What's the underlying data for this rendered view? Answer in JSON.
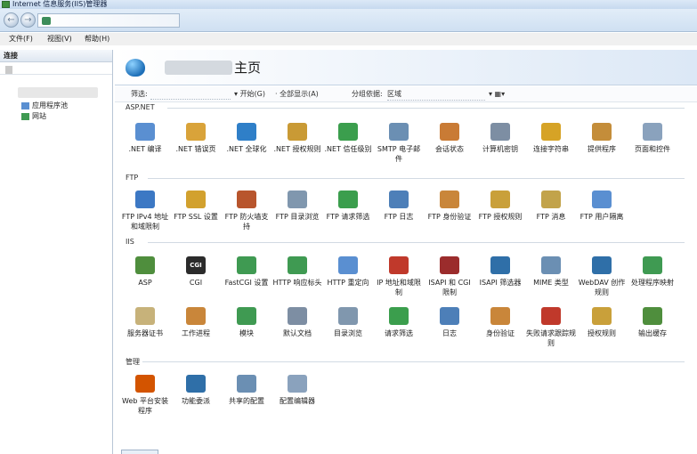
{
  "window": {
    "title": "Internet 信息服务(IIS)管理器"
  },
  "menu": [
    "文件(F)",
    "视图(V)",
    "帮助(H)"
  ],
  "connections": {
    "header": "连接",
    "tree": [
      {
        "label": "应用程序池",
        "icon": "app-pool-icon"
      },
      {
        "label": "网站",
        "icon": "sites-icon"
      }
    ]
  },
  "main": {
    "title": "主页",
    "filter": {
      "label": "筛选:",
      "start": "开始(G)",
      "show_all": "全部显示(A)",
      "group_by_label": "分组依据:",
      "group_by_value": "区域"
    },
    "sections": [
      {
        "name": "ASP.NET",
        "items": [
          {
            "label": ".NET 编译",
            "icon": "net-compile-icon",
            "color": "#5a8fd1"
          },
          {
            "label": ".NET 错误页",
            "icon": "net-error-page-icon",
            "color": "#d9a33a"
          },
          {
            "label": ".NET 全球化",
            "icon": "net-globalization-icon",
            "color": "#2f7fc8"
          },
          {
            "label": ".NET 授权规则",
            "icon": "net-authorization-icon",
            "color": "#c99a35"
          },
          {
            "label": ".NET 信任级别",
            "icon": "net-trust-level-icon",
            "color": "#3b9e4d"
          },
          {
            "label": "SMTP 电子邮件",
            "icon": "smtp-email-icon",
            "color": "#6b8fb3"
          },
          {
            "label": "会话状态",
            "icon": "session-state-icon",
            "color": "#c97b35"
          },
          {
            "label": "计算机密钥",
            "icon": "machine-key-icon",
            "color": "#7d8ea3"
          },
          {
            "label": "连接字符串",
            "icon": "connection-strings-icon",
            "color": "#d6a326"
          },
          {
            "label": "提供程序",
            "icon": "providers-icon",
            "color": "#c48d3a"
          },
          {
            "label": "页面和控件",
            "icon": "pages-controls-icon",
            "color": "#8aa2bd"
          }
        ]
      },
      {
        "name": "FTP",
        "items": [
          {
            "label": "FTP IPv4 地址和域限制",
            "icon": "ftp-ipv4-icon",
            "color": "#3c78c4"
          },
          {
            "label": "FTP SSL 设置",
            "icon": "ftp-ssl-icon",
            "color": "#d2a12e"
          },
          {
            "label": "FTP 防火墙支持",
            "icon": "ftp-firewall-icon",
            "color": "#b8552d"
          },
          {
            "label": "FTP 目录浏览",
            "icon": "ftp-directory-browsing-icon",
            "color": "#8097ae"
          },
          {
            "label": "FTP 请求筛选",
            "icon": "ftp-request-filtering-icon",
            "color": "#3b9e4d"
          },
          {
            "label": "FTP 日志",
            "icon": "ftp-logging-icon",
            "color": "#4d7fb8"
          },
          {
            "label": "FTP 身份验证",
            "icon": "ftp-authentication-icon",
            "color": "#c9863a"
          },
          {
            "label": "FTP 授权规则",
            "icon": "ftp-authorization-icon",
            "color": "#c9a03a"
          },
          {
            "label": "FTP 消息",
            "icon": "ftp-messages-icon",
            "color": "#c2a34a"
          },
          {
            "label": "FTP 用户隔离",
            "icon": "ftp-user-isolation-icon",
            "color": "#5a8fd1"
          }
        ]
      },
      {
        "name": "IIS",
        "items": [
          {
            "label": "ASP",
            "icon": "asp-icon",
            "color": "#4f8e3d"
          },
          {
            "label": "CGI",
            "icon": "cgi-icon",
            "color": "#2b2b2b",
            "text": "CGI"
          },
          {
            "label": "FastCGI 设置",
            "icon": "fastcgi-icon",
            "color": "#3f9a52"
          },
          {
            "label": "HTTP 响应标头",
            "icon": "http-response-headers-icon",
            "color": "#3f9a52"
          },
          {
            "label": "HTTP 重定向",
            "icon": "http-redirect-icon",
            "color": "#5a8fd1"
          },
          {
            "label": "IP 地址和域限制",
            "icon": "ip-domain-restrictions-icon",
            "color": "#c0392b"
          },
          {
            "label": "ISAPI 和 CGI 限制",
            "icon": "isapi-cgi-restrictions-icon",
            "color": "#9b2c2c"
          },
          {
            "label": "ISAPI 筛选器",
            "icon": "isapi-filters-icon",
            "color": "#2f6fa8"
          },
          {
            "label": "MIME 类型",
            "icon": "mime-types-icon",
            "color": "#6b8fb3"
          },
          {
            "label": "WebDAV 创作规则",
            "icon": "webdav-icon",
            "color": "#2f6fa8"
          },
          {
            "label": "处理程序映射",
            "icon": "handler-mappings-icon",
            "color": "#3f9a52"
          },
          {
            "label": "服务器证书",
            "icon": "server-certificates-icon",
            "color": "#c7b27a"
          },
          {
            "label": "工作进程",
            "icon": "worker-processes-icon",
            "color": "#c9863a"
          },
          {
            "label": "模块",
            "icon": "modules-icon",
            "color": "#3f9a52"
          },
          {
            "label": "默认文档",
            "icon": "default-document-icon",
            "color": "#7d8ea3"
          },
          {
            "label": "目录浏览",
            "icon": "directory-browsing-icon",
            "color": "#8097ae"
          },
          {
            "label": "请求筛选",
            "icon": "request-filtering-icon",
            "color": "#3b9e4d"
          },
          {
            "label": "日志",
            "icon": "logging-icon",
            "color": "#4d7fb8"
          },
          {
            "label": "身份验证",
            "icon": "authentication-icon",
            "color": "#c9863a"
          },
          {
            "label": "失败请求跟踪规则",
            "icon": "failed-request-tracing-icon",
            "color": "#c0392b"
          },
          {
            "label": "授权规则",
            "icon": "authorization-rules-icon",
            "color": "#c9a03a"
          },
          {
            "label": "输出缓存",
            "icon": "output-caching-icon",
            "color": "#4f8e3d"
          }
        ]
      },
      {
        "name": "管理",
        "items": [
          {
            "label": "Web 平台安装程序",
            "icon": "web-platform-installer-icon",
            "color": "#d35400"
          },
          {
            "label": "功能委派",
            "icon": "feature-delegation-icon",
            "color": "#2f6fa8"
          },
          {
            "label": "共享的配置",
            "icon": "shared-configuration-icon",
            "color": "#6b8fb3"
          },
          {
            "label": "配置编辑器",
            "icon": "configuration-editor-icon",
            "color": "#8aa2bd"
          }
        ]
      }
    ]
  }
}
